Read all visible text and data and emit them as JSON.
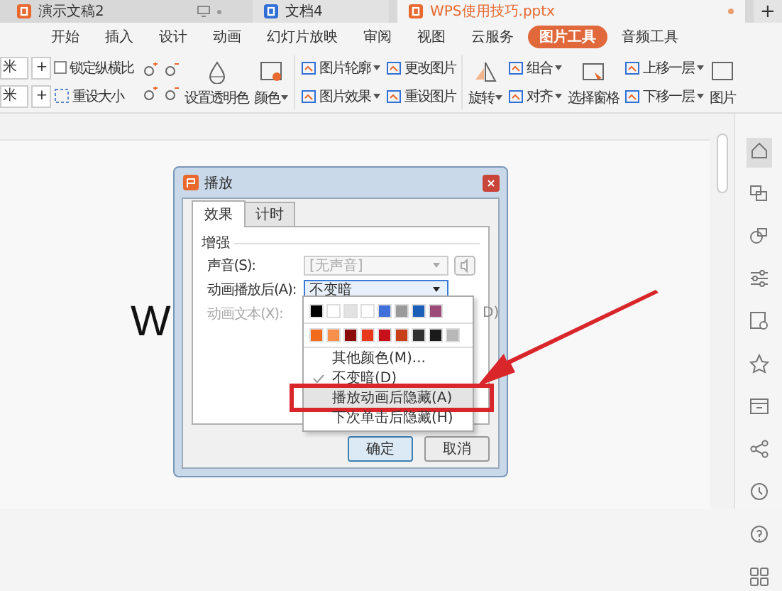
{
  "tabs": [
    {
      "label": "演示文稿2",
      "kind": "pres",
      "selected": false
    },
    {
      "label": "文档4",
      "kind": "doc",
      "selected": false
    },
    {
      "label": "WPS使用技巧.pptx",
      "kind": "pres",
      "selected": true
    }
  ],
  "new_tab": "+",
  "menu": [
    {
      "label": "开始",
      "selected": false
    },
    {
      "label": "插入",
      "selected": false
    },
    {
      "label": "设计",
      "selected": false
    },
    {
      "label": "动画",
      "selected": false
    },
    {
      "label": "幻灯片放映",
      "selected": false
    },
    {
      "label": "审阅",
      "selected": false
    },
    {
      "label": "视图",
      "selected": false
    },
    {
      "label": "云服务",
      "selected": false
    },
    {
      "label": "图片工具",
      "selected": true
    },
    {
      "label": "音频工具",
      "selected": false
    }
  ],
  "ribbon": {
    "size_fields": [
      {
        "unit": "米",
        "step": "+"
      },
      {
        "unit": "米",
        "step": "+"
      }
    ],
    "lock_ratio": {
      "label": "锁定纵横比",
      "checked": false
    },
    "reset_size": "重设大小",
    "groups": [
      {
        "kind": "big",
        "label": "设置透明色"
      },
      {
        "kind": "big",
        "label": "颜色",
        "caret": true
      },
      {
        "kind": "pair",
        "items": [
          {
            "label": "图片轮廓",
            "caret": true
          },
          {
            "label": "图片效果",
            "caret": true
          }
        ]
      },
      {
        "kind": "pair",
        "items": [
          {
            "label": "更改图片"
          },
          {
            "label": "重设图片"
          }
        ]
      },
      {
        "kind": "big",
        "label": "旋转",
        "caret": true
      },
      {
        "kind": "pair",
        "items": [
          {
            "label": "组合",
            "caret": true
          },
          {
            "label": "对齐",
            "caret": true
          }
        ]
      },
      {
        "kind": "big",
        "label": "选择窗格"
      },
      {
        "kind": "pair",
        "items": [
          {
            "label": "上移一层",
            "caret": true
          },
          {
            "label": "下移一层",
            "caret": true
          }
        ]
      },
      {
        "kind": "big",
        "label": "图片"
      }
    ]
  },
  "slide_text": "W",
  "dialog": {
    "title": "播放",
    "tabs": [
      {
        "label": "效果",
        "selected": true
      },
      {
        "label": "计时",
        "selected": false
      }
    ],
    "group": "增强",
    "rows": [
      {
        "kind": "combo",
        "label": "声音(S):",
        "value": "[无声音]",
        "disabled": true,
        "speaker": true
      },
      {
        "kind": "combo",
        "label": "动画播放后(A):",
        "value": "不变暗",
        "disabled": false
      },
      {
        "kind": "text",
        "label": "动画文本(X):",
        "disabled": true,
        "trailing": "D)"
      }
    ],
    "buttons": [
      {
        "label": "确定",
        "default": true
      },
      {
        "label": "取消",
        "default": false
      }
    ],
    "popup": {
      "swatch_rows": [
        [
          {
            "color": "#000000"
          },
          {
            "color": "#ffffff"
          },
          {
            "color": "#e2e2e2"
          },
          {
            "color": "#ffffff"
          },
          {
            "color": "#3f6fd8"
          },
          {
            "color": "#9a9a9a"
          },
          {
            "color": "#1c5fb8"
          },
          {
            "color": "#9c4a78"
          }
        ],
        [
          {
            "color": "#f26b1d"
          },
          {
            "color": "#f7904a"
          },
          {
            "color": "#8b0a0a"
          },
          {
            "color": "#e8371a"
          },
          {
            "color": "#c8101a"
          },
          {
            "color": "#c8401a"
          },
          {
            "color": "#303030"
          },
          {
            "color": "#1a1a1a"
          },
          {
            "color": "#b8b8b8"
          }
        ]
      ],
      "items": [
        {
          "label": "其他颜色(M)...",
          "checked": false,
          "selected": false,
          "annotated": false
        },
        {
          "label": "不变暗(D)",
          "checked": true,
          "selected": false,
          "annotated": false
        },
        {
          "label": "播放动画后隐藏(A)",
          "checked": false,
          "selected": true,
          "annotated": true
        },
        {
          "label": "下次单击后隐藏(H)",
          "checked": false,
          "selected": false,
          "annotated": false
        }
      ]
    }
  }
}
